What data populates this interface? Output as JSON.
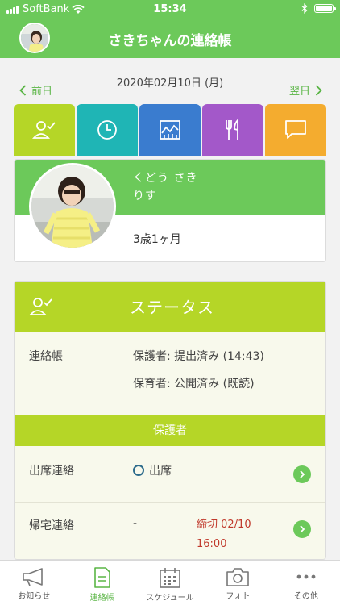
{
  "status_bar": {
    "carrier": "SoftBank",
    "time": "15:34"
  },
  "header": {
    "title": "さきちゃんの連絡帳"
  },
  "date_nav": {
    "date": "2020年02月10日 (月)",
    "prev_label": "前日",
    "next_label": "翌日"
  },
  "category_tabs": [
    {
      "icon": "person-check-icon",
      "color": "#b5d627"
    },
    {
      "icon": "clock-icon",
      "color": "#1fb5b5"
    },
    {
      "icon": "chart-icon",
      "color": "#3a7ccf"
    },
    {
      "icon": "fork-knife-icon",
      "color": "#a358c9"
    },
    {
      "icon": "chat-bubble-icon",
      "color": "#f4ac2f"
    }
  ],
  "profile": {
    "name_line1": "くどう さき",
    "name_line2": "りす",
    "age": "3歳1ヶ月"
  },
  "status_card": {
    "title": "ステータス",
    "renrakucho_label": "連絡帳",
    "guardian_status": "保護者: 提出済み (14:43)",
    "teacher_status": "保育者: 公開済み (既読)",
    "section_title": "保護者",
    "attendance_label": "出席連絡",
    "attendance_value": "出席",
    "pickup_label": "帰宅連絡",
    "pickup_value": "-",
    "deadline_line1": "締切 02/10",
    "deadline_line2": "16:00"
  },
  "tab_bar": {
    "items": [
      {
        "label": "お知らせ",
        "icon": "megaphone-icon"
      },
      {
        "label": "連絡帳",
        "icon": "document-icon"
      },
      {
        "label": "スケジュール",
        "icon": "calendar-icon"
      },
      {
        "label": "フォト",
        "icon": "camera-icon"
      },
      {
        "label": "その他",
        "icon": "more-icon"
      }
    ]
  },
  "colors": {
    "brand_green": "#6cc95a",
    "status_lime": "#b5d627",
    "deadline_red": "#c0392b"
  }
}
